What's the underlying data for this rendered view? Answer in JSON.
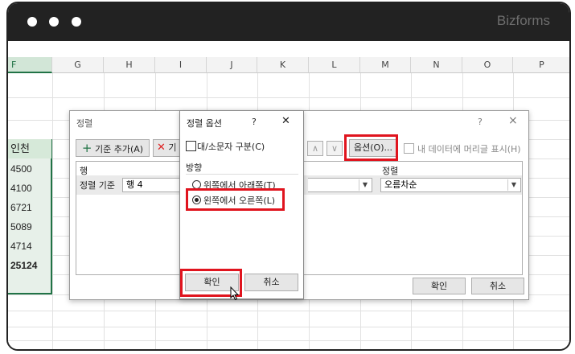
{
  "window": {
    "brand": "Bizforms"
  },
  "sheet": {
    "columns": [
      "F",
      "G",
      "H",
      "I",
      "J",
      "K",
      "L",
      "M",
      "N",
      "O",
      "P"
    ],
    "f_header": "인천",
    "f_values": [
      "4500",
      "4100",
      "6721",
      "5089",
      "4714",
      "25124"
    ]
  },
  "sort_dialog": {
    "title": "정렬",
    "help": "?",
    "close": "×",
    "add_level": "기준 추가(A)",
    "delete_level_partial": "기",
    "up": "∧",
    "down": "∨",
    "options_button": "옵션(O)...",
    "header_checkbox_label": "내 데이터에 머리글 표시(H)",
    "col_header_row": "행",
    "col_header_order": "정렬",
    "row_label": "정렬 기준",
    "row_value": "행 4",
    "order_value": "오름차순",
    "ok": "확인",
    "cancel": "취소"
  },
  "options_dialog": {
    "title": "정렬 옵션",
    "help": "?",
    "close": "✕",
    "case_sensitive": "대/소문자 구분(C)",
    "orientation_label": "방향",
    "top_to_bottom": "위쪽에서 아래쪽(T)",
    "left_to_right": "왼쪽에서 오른쪽(L)",
    "ok": "확인",
    "cancel": "취소"
  },
  "colors": {
    "titlebar": "#222222",
    "excel_green": "#217346",
    "highlight_red": "#e0141e"
  }
}
